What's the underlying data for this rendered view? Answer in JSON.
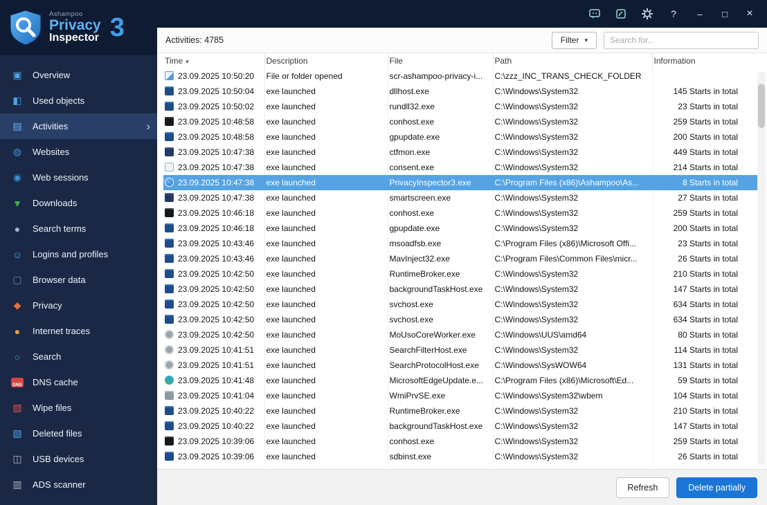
{
  "brand": {
    "company": "Ashampoo",
    "product_line1": "Privacy",
    "product_line2": "Inspector",
    "version": "3"
  },
  "titlebar": {
    "help_glyph": "?",
    "minimize_glyph": "–",
    "maximize_glyph": "□",
    "close_glyph": "×",
    "icons": [
      "feedback-icon",
      "edit-note-icon",
      "settings-icon",
      "help-icon",
      "minimize-icon",
      "maximize-icon",
      "close-icon"
    ]
  },
  "sidebar": {
    "selected": "Activities",
    "items": [
      {
        "id": "overview",
        "label": "Overview",
        "icon": "monitor-icon",
        "glyph": "▣",
        "color": "#4da3e8",
        "selected": false
      },
      {
        "id": "used-objects",
        "label": "Used objects",
        "icon": "box-icon",
        "glyph": "◧",
        "color": "#4da3e8",
        "selected": false
      },
      {
        "id": "activities",
        "label": "Activities",
        "icon": "activity-chart-icon",
        "glyph": "▤",
        "color": "#62b8f0",
        "selected": true
      },
      {
        "id": "websites",
        "label": "Websites",
        "icon": "www-globe-icon",
        "glyph": "◍",
        "color": "#3f8fd6",
        "selected": false
      },
      {
        "id": "web-sessions",
        "label": "Web sessions",
        "icon": "globe-icon",
        "glyph": "◉",
        "color": "#3f8fd6",
        "selected": false
      },
      {
        "id": "downloads",
        "label": "Downloads",
        "icon": "download-icon",
        "glyph": "▼",
        "color": "#43b04a",
        "selected": false
      },
      {
        "id": "search-terms",
        "label": "Search terms",
        "icon": "magnifier-icon",
        "glyph": "●",
        "color": "#9fb8d8",
        "selected": false
      },
      {
        "id": "logins-profiles",
        "label": "Logins and profiles",
        "icon": "user-icon",
        "glyph": "☺",
        "color": "#4da3e8",
        "selected": false
      },
      {
        "id": "browser-data",
        "label": "Browser data",
        "icon": "browser-window-icon",
        "glyph": "▢",
        "color": "#5b87c5",
        "selected": false
      },
      {
        "id": "privacy",
        "label": "Privacy",
        "icon": "shield-icon",
        "glyph": "◆",
        "color": "#e8703a",
        "selected": false
      },
      {
        "id": "internet-traces",
        "label": "Internet traces",
        "icon": "cookie-icon",
        "glyph": "●",
        "color": "#e8a13c",
        "selected": false
      },
      {
        "id": "search",
        "label": "Search",
        "icon": "search-globe-icon",
        "glyph": "○",
        "color": "#37b0c8",
        "selected": false
      },
      {
        "id": "dns-cache",
        "label": "DNS cache",
        "icon": "dns-badge-icon",
        "glyph": "DNS",
        "color": "#d64545",
        "selected": false,
        "badge": true
      },
      {
        "id": "wipe-files",
        "label": "Wipe files",
        "icon": "wipe-icon",
        "glyph": "▨",
        "color": "#e05252",
        "selected": false
      },
      {
        "id": "deleted-files",
        "label": "Deleted files",
        "icon": "trash-icon",
        "glyph": "▧",
        "color": "#4da3e8",
        "selected": false
      },
      {
        "id": "usb-devices",
        "label": "USB devices",
        "icon": "usb-icon",
        "glyph": "◫",
        "color": "#aab4c0",
        "selected": false
      },
      {
        "id": "ads-scanner",
        "label": "ADS scanner",
        "icon": "scanner-icon",
        "glyph": "▥",
        "color": "#aab4c0",
        "selected": false
      }
    ]
  },
  "toolbar": {
    "activities_count": "Activities: 4785",
    "filter_label": "Filter",
    "filter_caret": "▾",
    "search_placeholder": "Search for..."
  },
  "table": {
    "columns": [
      "Time",
      "Description",
      "File",
      "Path",
      "Information"
    ],
    "sort": {
      "column": "Time",
      "glyph": "▾"
    },
    "rows": [
      {
        "icon": "doc-blue",
        "time": "23.09.2025 10:50:20",
        "desc": "File or folder opened",
        "file": "scr-ashampoo-privacy-i...",
        "path": "C:\\zzz_INC_TRANS_CHECK_FOLDER",
        "info": "",
        "selected": false
      },
      {
        "icon": "win-blue",
        "time": "23.09.2025 10:50:04",
        "desc": "exe launched",
        "file": "dllhost.exe",
        "path": "C:\\Windows\\System32",
        "info": "145 Starts in total",
        "selected": false
      },
      {
        "icon": "win-blue",
        "time": "23.09.2025 10:50:02",
        "desc": "exe launched",
        "file": "rundll32.exe",
        "path": "C:\\Windows\\System32",
        "info": "23 Starts in total",
        "selected": false
      },
      {
        "icon": "win-black",
        "time": "23.09.2025 10:48:58",
        "desc": "exe launched",
        "file": "conhost.exe",
        "path": "C:\\Windows\\System32",
        "info": "259 Starts in total",
        "selected": false
      },
      {
        "icon": "win-blue",
        "time": "23.09.2025 10:48:58",
        "desc": "exe launched",
        "file": "gpupdate.exe",
        "path": "C:\\Windows\\System32",
        "info": "200 Starts in total",
        "selected": false
      },
      {
        "icon": "win-dark",
        "time": "23.09.2025 10:47:38",
        "desc": "exe launched",
        "file": "ctfmon.exe",
        "path": "C:\\Windows\\System32",
        "info": "449 Starts in total",
        "selected": false
      },
      {
        "icon": "win-light",
        "time": "23.09.2025 10:47:38",
        "desc": "exe launched",
        "file": "consent.exe",
        "path": "C:\\Windows\\System32",
        "info": "214 Starts in total",
        "selected": false
      },
      {
        "icon": "app-logo",
        "time": "23.09.2025 10:47:38",
        "desc": "exe launched",
        "file": "PrivacyInspector3.exe",
        "path": "C:\\Program Files (x86)\\Ashampoo\\As...",
        "info": "8 Starts in total",
        "selected": true
      },
      {
        "icon": "win-dark",
        "time": "23.09.2025 10:47:38",
        "desc": "exe launched",
        "file": "smartscreen.exe",
        "path": "C:\\Windows\\System32",
        "info": "27 Starts in total",
        "selected": false
      },
      {
        "icon": "win-black",
        "time": "23.09.2025 10:46:18",
        "desc": "exe launched",
        "file": "conhost.exe",
        "path": "C:\\Windows\\System32",
        "info": "259 Starts in total",
        "selected": false
      },
      {
        "icon": "win-blue",
        "time": "23.09.2025 10:46:18",
        "desc": "exe launched",
        "file": "gpupdate.exe",
        "path": "C:\\Windows\\System32",
        "info": "200 Starts in total",
        "selected": false
      },
      {
        "icon": "win-blue",
        "time": "23.09.2025 10:43:46",
        "desc": "exe launched",
        "file": "msoadfsb.exe",
        "path": "C:\\Program Files (x86)\\Microsoft Offi...",
        "info": "23 Starts in total",
        "selected": false
      },
      {
        "icon": "win-blue",
        "time": "23.09.2025 10:43:46",
        "desc": "exe launched",
        "file": "MavInject32.exe",
        "path": "C:\\Program Files\\Common Files\\micr...",
        "info": "26 Starts in total",
        "selected": false
      },
      {
        "icon": "win-blue",
        "time": "23.09.2025 10:42:50",
        "desc": "exe launched",
        "file": "RuntimeBroker.exe",
        "path": "C:\\Windows\\System32",
        "info": "210 Starts in total",
        "selected": false
      },
      {
        "icon": "win-blue",
        "time": "23.09.2025 10:42:50",
        "desc": "exe launched",
        "file": "backgroundTaskHost.exe",
        "path": "C:\\Windows\\System32",
        "info": "147 Starts in total",
        "selected": false
      },
      {
        "icon": "win-blue",
        "time": "23.09.2025 10:42:50",
        "desc": "exe launched",
        "file": "svchost.exe",
        "path": "C:\\Windows\\System32",
        "info": "634 Starts in total",
        "selected": false
      },
      {
        "icon": "win-blue",
        "time": "23.09.2025 10:42:50",
        "desc": "exe launched",
        "file": "svchost.exe",
        "path": "C:\\Windows\\System32",
        "info": "634 Starts in total",
        "selected": false
      },
      {
        "icon": "gear-gray",
        "time": "23.09.2025 10:42:50",
        "desc": "exe launched",
        "file": "MoUsoCoreWorker.exe",
        "path": "C:\\Windows\\UUS\\amd64",
        "info": "80 Starts in total",
        "selected": false
      },
      {
        "icon": "gear-gray",
        "time": "23.09.2025 10:41:51",
        "desc": "exe launched",
        "file": "SearchFilterHost.exe",
        "path": "C:\\Windows\\System32",
        "info": "114 Starts in total",
        "selected": false
      },
      {
        "icon": "gear-gray",
        "time": "23.09.2025 10:41:51",
        "desc": "exe launched",
        "file": "SearchProtocolHost.exe",
        "path": "C:\\Windows\\SysWOW64",
        "info": "131 Starts in total",
        "selected": false
      },
      {
        "icon": "globe-green",
        "time": "23.09.2025 10:41:48",
        "desc": "exe launched",
        "file": "MicrosoftEdgeUpdate.e...",
        "path": "C:\\Program Files (x86)\\Microsoft\\Ed...",
        "info": "59 Starts in total",
        "selected": false
      },
      {
        "icon": "tool-gray",
        "time": "23.09.2025 10:41:04",
        "desc": "exe launched",
        "file": "WmiPrvSE.exe",
        "path": "C:\\Windows\\System32\\wbem",
        "info": "104 Starts in total",
        "selected": false
      },
      {
        "icon": "win-blue",
        "time": "23.09.2025 10:40:22",
        "desc": "exe launched",
        "file": "RuntimeBroker.exe",
        "path": "C:\\Windows\\System32",
        "info": "210 Starts in total",
        "selected": false
      },
      {
        "icon": "win-blue",
        "time": "23.09.2025 10:40:22",
        "desc": "exe launched",
        "file": "backgroundTaskHost.exe",
        "path": "C:\\Windows\\System32",
        "info": "147 Starts in total",
        "selected": false
      },
      {
        "icon": "win-black",
        "time": "23.09.2025 10:39:06",
        "desc": "exe launched",
        "file": "conhost.exe",
        "path": "C:\\Windows\\System32",
        "info": "259 Starts in total",
        "selected": false
      },
      {
        "icon": "win-blue",
        "time": "23.09.2025 10:39:06",
        "desc": "exe launched",
        "file": "sdbinst.exe",
        "path": "C:\\Windows\\System32",
        "info": "26 Starts in total",
        "selected": false
      }
    ]
  },
  "footer": {
    "refresh_label": "Refresh",
    "delete_label": "Delete partially"
  },
  "colors": {
    "accent": "#1b75d6",
    "selected_row": "#55a3e3",
    "sidebar_bg": "#1a2845",
    "titlebar_bg": "#0e1b33"
  }
}
